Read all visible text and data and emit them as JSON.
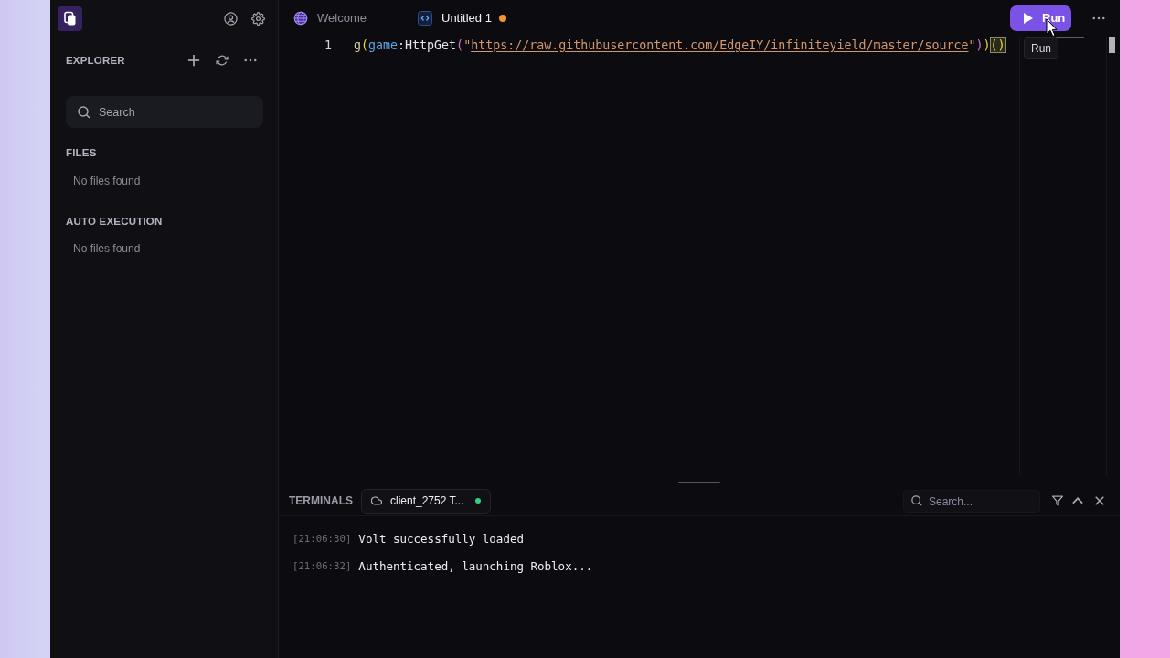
{
  "sidebar": {
    "title": "EXPLORER",
    "search": {
      "placeholder": "Search"
    },
    "sections": [
      {
        "title": "FILES",
        "empty_text": "No files found"
      },
      {
        "title": "AUTO EXECUTION",
        "empty_text": "No files found"
      }
    ]
  },
  "tabs": [
    {
      "label": "Welcome",
      "kind": "welcome",
      "selected": false,
      "modified": false
    },
    {
      "label": "Untitled 1",
      "kind": "script",
      "selected": true,
      "modified": true
    }
  ],
  "run_button": {
    "label": "Run",
    "tooltip": "Run"
  },
  "editor": {
    "lines": [
      {
        "number": "1",
        "tokens": [
          {
            "text": "g",
            "kind": "call"
          },
          {
            "text": "(",
            "kind": "bracket_1"
          },
          {
            "text": "game",
            "kind": "global"
          },
          {
            "text": ":HttpGet",
            "kind": "method"
          },
          {
            "text": "(",
            "kind": "bracket_2"
          },
          {
            "text": "\"",
            "kind": "string"
          },
          {
            "text": "https://raw.githubusercontent.com/EdgeIY/infiniteyield/master/source",
            "kind": "link"
          },
          {
            "text": "\"",
            "kind": "string"
          },
          {
            "text": ")",
            "kind": "bracket_2"
          },
          {
            "text": ")",
            "kind": "bracket_1"
          },
          {
            "text": "()",
            "kind": "matched_pair"
          }
        ]
      }
    ]
  },
  "terminal": {
    "title": "TERMINALS",
    "sessions": [
      {
        "label": "client_2752 T...",
        "selected": true,
        "connected": true
      }
    ],
    "search": {
      "placeholder": "Search..."
    },
    "log": [
      {
        "time": "[21:06:30]",
        "message": "Volt successfully loaded"
      },
      {
        "time": "[21:06:32]",
        "message": "Authenticated, launching Roblox..."
      }
    ]
  }
}
